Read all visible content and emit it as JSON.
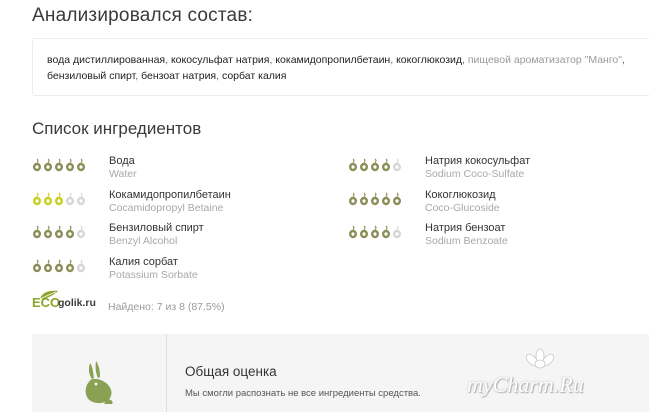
{
  "analysis": {
    "title": "Анализировался состав:",
    "ingredients_text": [
      {
        "text": "вода дистиллированная",
        "known": true
      },
      {
        "text": "кокосульфат натрия",
        "known": true
      },
      {
        "text": "кокамидопропилбетаин",
        "known": true
      },
      {
        "text": "кокоглюкозид",
        "known": true
      },
      {
        "text": "пищевой ароматизатор \"Манго\"",
        "known": false
      },
      {
        "text": "бензиловый спирт",
        "known": true
      },
      {
        "text": "бензоат натрия",
        "known": true
      },
      {
        "text": "сорбат калия",
        "known": true
      }
    ],
    "separator": ", "
  },
  "list": {
    "title": "Список ингредиентов",
    "items": [
      {
        "name": "Вода",
        "latin": "Water",
        "rating": 5,
        "color": "#8a8d55"
      },
      {
        "name": "Натрия кокосульфат",
        "latin": "Sodium Coco-Sulfate",
        "rating": 4,
        "color": "#8a8d55"
      },
      {
        "name": "Кокамидопропилбетаин",
        "latin": "Cocamidopropyl Betaine",
        "rating": 3,
        "color": "#c9cf1c"
      },
      {
        "name": "Кокоглюкозид",
        "latin": "Coco-Glucoside",
        "rating": 5,
        "color": "#8a8d55"
      },
      {
        "name": "Бензиловый спирт",
        "latin": "Benzyl Alcohol",
        "rating": 4,
        "color": "#8a8d55"
      },
      {
        "name": "Натрия бензоат",
        "latin": "Sodium Benzoate",
        "rating": 4,
        "color": "#8a8d55"
      },
      {
        "name": "Калия сорбат",
        "latin": "Potassium Sorbate",
        "rating": 4,
        "color": "#8a8d55"
      }
    ]
  },
  "footer": {
    "logo_eco": "ECO",
    "logo_site": "golik.ru",
    "found_text": "Найдено: 7 из 8 (87.5%)"
  },
  "summary": {
    "title": "Общая оценка",
    "text": "Мы смогли распознать не все ингредиенты средства."
  },
  "watermark": "myCharm.Ru",
  "colors": {
    "accent": "#8aa52a",
    "dot_empty": "#d6d6d6"
  }
}
